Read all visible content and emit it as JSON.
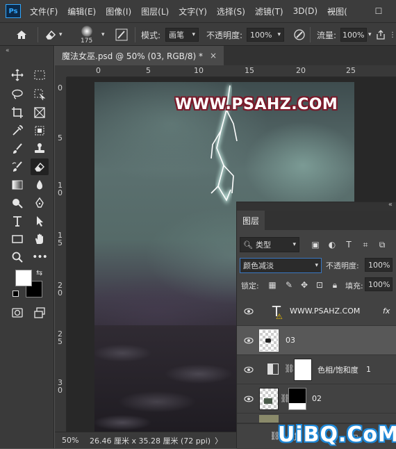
{
  "menubar": {
    "logo": "Ps",
    "items": [
      "文件(F)",
      "编辑(E)",
      "图像(I)",
      "图层(L)",
      "文字(Y)",
      "选择(S)",
      "滤镜(T)",
      "3D(D)",
      "视图("
    ],
    "minimize": "—",
    "maximize": "☐"
  },
  "options": {
    "brush_size": "175",
    "mode_label": "模式:",
    "mode_value": "画笔",
    "opacity_label": "不透明度:",
    "opacity_value": "100%",
    "flow_label": "流量:",
    "flow_value": "100%"
  },
  "document": {
    "tab_title": "魔法女巫.psd @ 50% (03, RGB/8) *",
    "close": "×",
    "ruler_h": [
      "0",
      "5",
      "10",
      "15",
      "20",
      "25"
    ],
    "ruler_v": [
      "0",
      "5",
      "1\n0",
      "1\n5",
      "2\n0",
      "2\n5",
      "3\n0"
    ]
  },
  "canvas": {
    "watermark": "WWW.PSAHZ.COM"
  },
  "status": {
    "zoom": "50%",
    "size": "26.46 厘米 x 35.28 厘米 (72 ppi)",
    "arrow": "〉"
  },
  "layers_panel": {
    "tab": "图层",
    "filter_kind": "类型",
    "blend_mode": "颜色减淡",
    "opacity_label": "不透明度:",
    "opacity_value": "100%",
    "lock_label": "锁定:",
    "fill_label": "填充:",
    "fill_value": "100%",
    "layers": [
      {
        "name": "WWW.PSAHZ.COM",
        "fx": "fx"
      },
      {
        "name": "03"
      },
      {
        "name": "色相/饱和度",
        "num": "1"
      },
      {
        "name": "02"
      }
    ]
  },
  "footer_watermark": "UiBQ.CoM",
  "colors": {
    "accent": "#31a8ff",
    "foreground": "#ffffff",
    "background": "#000000"
  }
}
